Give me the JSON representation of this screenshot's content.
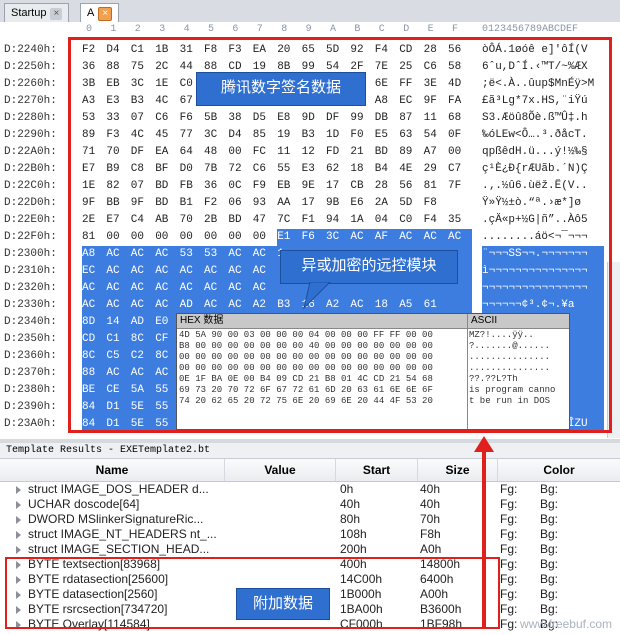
{
  "tabs": [
    {
      "label": "Startup",
      "close": "×"
    },
    {
      "label": "A",
      "close": "×"
    }
  ],
  "hex_header": {
    "columns": [
      "0",
      "1",
      "2",
      "3",
      "4",
      "5",
      "6",
      "7",
      "8",
      "9",
      "A",
      "B",
      "C",
      "D",
      "E",
      "F"
    ],
    "ascii_header": "0123456789ABCDEF"
  },
  "rows": [
    {
      "addr": "D:2240h:",
      "bytes": [
        "F2",
        "D4",
        "C1",
        "1B",
        "31",
        "F8",
        "F3",
        "EA",
        "20",
        "65",
        "5D",
        "92",
        "F4",
        "CD",
        "28",
        "56"
      ],
      "ascii": "òÔÁ.1øóê e]'ôÍ(V",
      "sel_from": 99
    },
    {
      "addr": "D:2250h:",
      "bytes": [
        "36",
        "88",
        "75",
        "2C",
        "44",
        "88",
        "CD",
        "19",
        "8B",
        "99",
        "54",
        "2F",
        "7E",
        "25",
        "C6",
        "58"
      ],
      "ascii": "6ˆu,DˆÍ.‹™T/~%ÆX",
      "sel_from": 99
    },
    {
      "addr": "D:2260h:",
      "bytes": [
        "3B",
        "EB",
        "3C",
        "1E",
        "C0",
        "00",
        "07",
        "0B",
        "75",
        "70",
        "24",
        "4D",
        "6E",
        "FF",
        "3E",
        "4D"
      ],
      "ascii": ";ë<.À..ûup$MnÉÿ>M",
      "sel_from": 99
    },
    {
      "addr": "D:2270h:",
      "bytes": [
        "A3",
        "E3",
        "B3",
        "4C",
        "67",
        "00",
        "00",
        "00",
        "00",
        "00",
        "00",
        "00",
        "A8",
        "EC",
        "9F",
        "FA"
      ],
      "ascii": "£ã³Lg*7x.HS,¨iŸú",
      "sel_from": 99
    },
    {
      "addr": "D:2280h:",
      "bytes": [
        "53",
        "33",
        "07",
        "C6",
        "F6",
        "5B",
        "38",
        "D5",
        "E8",
        "9D",
        "DF",
        "99",
        "DB",
        "87",
        "11",
        "68"
      ],
      "ascii": "S3.Æöû8Õè.ß™Û‡.h",
      "sel_from": 99
    },
    {
      "addr": "D:2290h:",
      "bytes": [
        "89",
        "F3",
        "4C",
        "45",
        "77",
        "3C",
        "D4",
        "85",
        "19",
        "B3",
        "1D",
        "F0",
        "E5",
        "63",
        "54",
        "0F"
      ],
      "ascii": "‰óLEw<Ô….³.ðåcT.",
      "sel_from": 99
    },
    {
      "addr": "D:22A0h:",
      "bytes": [
        "71",
        "70",
        "DF",
        "EA",
        "64",
        "48",
        "00",
        "FC",
        "11",
        "12",
        "FD",
        "21",
        "BD",
        "89",
        "A7",
        "00"
      ],
      "ascii": "qpßêdH.ü...ý!½‰§",
      "sel_from": 99
    },
    {
      "addr": "D:22B0h:",
      "bytes": [
        "E7",
        "B9",
        "C8",
        "BF",
        "D0",
        "7B",
        "72",
        "C6",
        "55",
        "E3",
        "62",
        "18",
        "B4",
        "4E",
        "29",
        "C7"
      ],
      "ascii": "ç¹È¿Ð{rÆUãb.´N)Ç",
      "sel_from": 99
    },
    {
      "addr": "D:22C0h:",
      "bytes": [
        "1E",
        "82",
        "07",
        "BD",
        "FB",
        "36",
        "0C",
        "F9",
        "EB",
        "9E",
        "17",
        "CB",
        "28",
        "56",
        "81",
        "7F"
      ],
      "ascii": ".‚.½û6.ùëž.Ë(V..",
      "sel_from": 99
    },
    {
      "addr": "D:22D0h:",
      "bytes": [
        "9F",
        "BB",
        "9F",
        "BD",
        "B1",
        "F2",
        "06",
        "93",
        "AA",
        "17",
        "9B",
        "E6",
        "2A",
        "5D",
        "F8"
      ],
      "ascii": "Ÿ»Ÿ½±ò.“ª.›æ*]ø",
      "sel_from": 99
    },
    {
      "addr": "D:22E0h:",
      "bytes": [
        "2E",
        "E7",
        "C4",
        "AB",
        "70",
        "2B",
        "BD",
        "47",
        "7C",
        "F1",
        "94",
        "1A",
        "04",
        "C0",
        "F4",
        "35"
      ],
      "ascii": ".çÄ«p+½G|ñ”..Àô5",
      "sel_from": 99
    },
    {
      "addr": "D:22F0h:",
      "bytes": [
        "81",
        "00",
        "00",
        "00",
        "00",
        "00",
        "00",
        "00",
        "E1",
        "F6",
        "3C",
        "AC",
        "AF",
        "AC",
        "AC",
        "AC"
      ],
      "ascii": "........áö<¬¯¬¬¬",
      "sel_from": 8
    },
    {
      "addr": "D:2300h:",
      "bytes": [
        "A8",
        "AC",
        "AC",
        "AC",
        "53",
        "53",
        "AC",
        "AC",
        "1",
        "",
        "",
        "",
        "",
        "",
        "",
        ""
      ],
      "ascii": "¨¬¬¬SS¬¬.¬¬¬¬¬¬¬",
      "sel_from": 0
    },
    {
      "addr": "D:2310h:",
      "bytes": [
        "EC",
        "AC",
        "AC",
        "AC",
        "AC",
        "AC",
        "AC",
        "AC",
        "",
        "",
        "",
        "",
        "",
        "",
        "",
        ""
      ],
      "ascii": "ì¬¬¬¬¬¬¬¬¬¬¬¬¬¬¬",
      "sel_from": 0
    },
    {
      "addr": "D:2320h:",
      "bytes": [
        "AC",
        "AC",
        "AC",
        "AC",
        "AC",
        "AC",
        "AC",
        "AC",
        "",
        "",
        "",
        "",
        "",
        "",
        "",
        ""
      ],
      "ascii": "¬¬¬¬¬¬¬¬¬¬¬¬¬¬¬¬",
      "sel_from": 0
    },
    {
      "addr": "D:2330h:",
      "bytes": [
        "AC",
        "AC",
        "AC",
        "AC",
        "AD",
        "AC",
        "AC",
        "A2",
        "B3",
        "16",
        "A2",
        "AC",
        "18",
        "A5",
        "61",
        ""
      ],
      "ascii": "¬¬¬¬­¬¬¢³.¢¬.¥a",
      "sel_from": 0
    },
    {
      "addr": "D:2340h:",
      "bytes": [
        "8D",
        "14",
        "AD",
        "E0",
        "",
        "",
        "",
        "",
        "",
        "",
        "",
        "",
        "",
        "",
        "",
        ""
      ],
      "ascii": "..­àÛ ÃÆÐ",
      "sel_from": 0
    },
    {
      "addr": "D:2350h:",
      "bytes": [
        "CD",
        "C1",
        "8C",
        "CF",
        "",
        "",
        "",
        "",
        "",
        "",
        "",
        "",
        "",
        "",
        "",
        ""
      ],
      "ascii": "ÍÁŒÏ ÆŒÞÚÄ",
      "sel_from": 0
    },
    {
      "addr": "D:2360h:",
      "bytes": [
        "8C",
        "C5",
        "C2",
        "8C",
        "",
        "",
        "",
        "",
        "",
        "",
        "",
        "",
        "",
        "",
        "",
        ""
      ],
      "ascii": "ŒÅÂŒ ¦;;¦",
      "sel_from": 0
    },
    {
      "addr": "D:2370h:",
      "bytes": [
        "88",
        "AC",
        "AC",
        "AC",
        "",
        "",
        "",
        "",
        "",
        "",
        "",
        "",
        "",
        "",
        "",
        ""
      ],
      "ascii": "ˆ¬¬¬ ¬¬¬¬¬",
      "sel_from": 0
    },
    {
      "addr": "D:2380h:",
      "bytes": [
        "BE",
        "CE",
        "5A",
        "55",
        "",
        "",
        "",
        "",
        "",
        "",
        "",
        "",
        "",
        "",
        "",
        ""
      ],
      "ascii": "¾ÎZU ÉÎZU",
      "sel_from": 0
    },
    {
      "addr": "D:2390h:",
      "bytes": [
        "84",
        "D1",
        "5E",
        "55",
        "",
        "",
        "",
        "",
        "",
        "",
        "",
        "",
        "",
        "",
        "",
        ""
      ],
      "ascii": "„Ñ^U ÉÎZU",
      "sel_from": 0
    },
    {
      "addr": "D:23A0h:",
      "bytes": [
        "84",
        "D1",
        "5E",
        "55",
        "E9",
        "CE",
        "5A",
        "55",
        "DD",
        "E8",
        "51",
        "55",
        "E9",
        "CE",
        "5A",
        "55"
      ],
      "ascii": "„Ñ^UéÎZUÝèQUéÎZU",
      "sel_from": 0
    }
  ],
  "callouts": {
    "signature": "腾讯数字签名数据",
    "remote": "异或加密的远控模块",
    "overlay": "附加数据"
  },
  "popup": {
    "hex_title": "HEX 数据",
    "ascii_title": "ASCII",
    "hex_lines": [
      "4D 5A 90 00 03 00 00 00 04 00 00 00 FF FF 00 00",
      "B8 00 00 00 00 00 00 00 40 00 00 00 00 00 00 00",
      "00 00 00 00 00 00 00 00 00 00 00 00 00 00 00 00",
      "00 00 00 00 00 00 00 00 00 00 00 00 00 00 00 00",
      "0E 1F BA 0E 00 B4 09 CD 21 B8 01 4C CD 21 54 68",
      "69 73 20 70 72 6F 67 72 61 6D 20 63 61 6E 6E 6F",
      "74 20 62 65 20 72 75 6E 20 69 6E 20 44 4F 53 20"
    ],
    "ascii_lines": [
      "MZ?!....ÿÿ..",
      "?.......@......",
      "...............",
      "...............",
      "??.??L?Th",
      "is program canno",
      "t be run in DOS"
    ]
  },
  "template_results": {
    "title": "Template Results - EXETemplate2.bt",
    "columns": [
      "Name",
      "Value",
      "Start",
      "Size",
      "Color"
    ],
    "rows": [
      {
        "name": "struct IMAGE_DOS_HEADER d...",
        "value": "",
        "start": "0h",
        "size": "40h",
        "fg": "Fg:",
        "bg": "Bg:"
      },
      {
        "name": "UCHAR doscode[64]",
        "value": "",
        "start": "40h",
        "size": "40h",
        "fg": "Fg:",
        "bg": "Bg:"
      },
      {
        "name": "DWORD MSlinkerSignatureRic...",
        "value": "",
        "start": "80h",
        "size": "70h",
        "fg": "Fg:",
        "bg": "Bg:"
      },
      {
        "name": "struct IMAGE_NT_HEADERS nt_...",
        "value": "",
        "start": "108h",
        "size": "F8h",
        "fg": "Fg:",
        "bg": "Bg:"
      },
      {
        "name": "struct IMAGE_SECTION_HEAD...",
        "value": "",
        "start": "200h",
        "size": "A0h",
        "fg": "Fg:",
        "bg": "Bg:"
      },
      {
        "name": "BYTE textsection[83968]",
        "value": "",
        "start": "400h",
        "size": "14800h",
        "fg": "Fg:",
        "bg": "Bg:"
      },
      {
        "name": "BYTE rdatasection[25600]",
        "value": "",
        "start": "14C00h",
        "size": "6400h",
        "fg": "Fg:",
        "bg": "Bg:"
      },
      {
        "name": "BYTE datasection[2560]",
        "value": "",
        "start": "1B000h",
        "size": "A00h",
        "fg": "Fg:",
        "bg": "Bg:"
      },
      {
        "name": "BYTE rsrcsection[734720]",
        "value": "",
        "start": "1BA00h",
        "size": "B3600h",
        "fg": "Fg:",
        "bg": "Bg:"
      },
      {
        "name": "BYTE Overlay[114584]",
        "value": "",
        "start": "CF000h",
        "size": "1BF98h",
        "fg": "Fg:",
        "bg": "Bg:"
      }
    ]
  },
  "watermark": "www.freebuf.com",
  "colors": {
    "selection": "#3d7de0",
    "annotation": "#e0201c",
    "callout": "#2f6fd0"
  }
}
